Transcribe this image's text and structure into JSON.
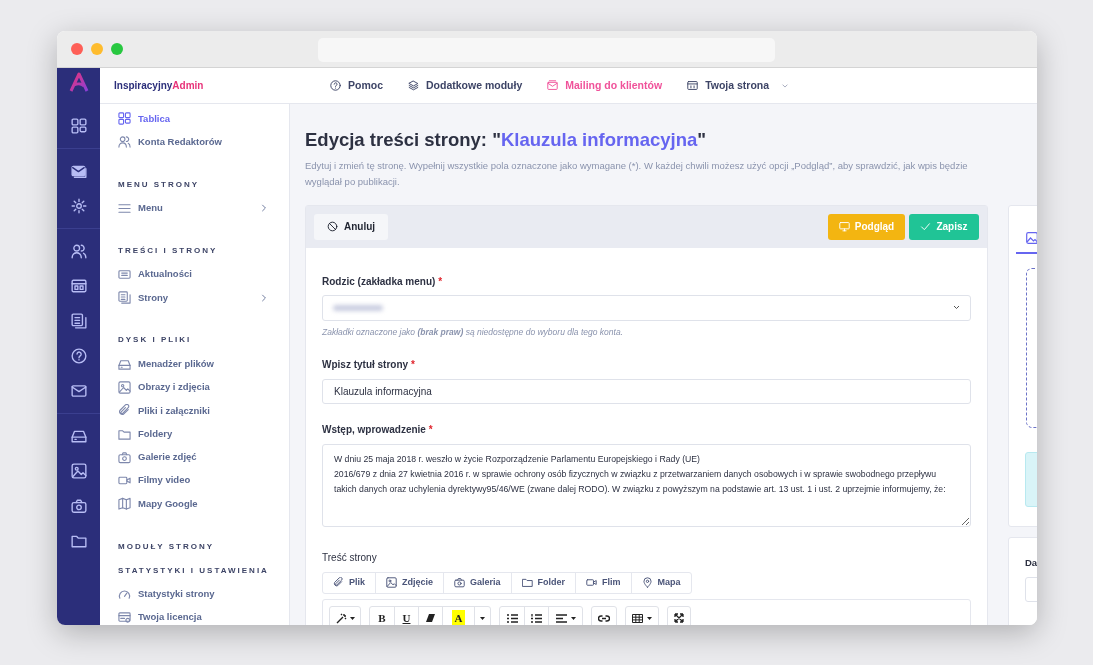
{
  "topbar": {
    "brand": {
      "first": "Inspiracyjny",
      "second": "Admin"
    },
    "nav": [
      {
        "label": "Pomoc",
        "selected": false,
        "dropdown": false
      },
      {
        "label": "Dodatkowe moduły",
        "selected": false,
        "dropdown": false
      },
      {
        "label": "Mailing do klientów",
        "selected": true,
        "dropdown": false
      },
      {
        "label": "Twoja strona",
        "selected": false,
        "dropdown": true
      }
    ]
  },
  "sidebar": {
    "sections": [
      {
        "items": [
          {
            "label": "Tablica",
            "selected": true,
            "submenu": false
          },
          {
            "label": "Konta Redaktorów",
            "selected": false,
            "submenu": false
          }
        ]
      },
      {
        "heading": "MENU STRONY",
        "items": [
          {
            "label": "Menu",
            "selected": false,
            "submenu": true
          }
        ]
      },
      {
        "heading": "TREŚCI I STRONY",
        "items": [
          {
            "label": "Aktualności",
            "selected": false,
            "submenu": false
          },
          {
            "label": "Strony",
            "selected": false,
            "submenu": true
          }
        ]
      },
      {
        "heading": "DYSK I PLIKI",
        "items": [
          {
            "label": "Menadżer plików",
            "selected": false,
            "submenu": false
          },
          {
            "label": "Obrazy i zdjęcia",
            "selected": false,
            "submenu": false
          },
          {
            "label": "Pliki i załączniki",
            "selected": false,
            "submenu": false
          },
          {
            "label": "Foldery",
            "selected": false,
            "submenu": false
          },
          {
            "label": "Galerie zdjęć",
            "selected": false,
            "submenu": false
          },
          {
            "label": "Filmy video",
            "selected": false,
            "submenu": false
          },
          {
            "label": "Mapy Google",
            "selected": false,
            "submenu": false
          }
        ]
      },
      {
        "heading": "MODUŁY STRONY"
      },
      {
        "heading": "STATYSTYKI I USTAWIENIA",
        "items": [
          {
            "label": "Statystyki strony",
            "selected": false,
            "submenu": false
          },
          {
            "label": "Twoja licencja",
            "selected": false,
            "submenu": false
          }
        ]
      }
    ]
  },
  "page": {
    "title_prefix": "Edycja treści strony: \"",
    "title_highlight": "Klauzula informacyjna",
    "title_suffix": "\"",
    "description": "Edytuj i zmień tę stronę. Wypełnij wszystkie pola oznaczone jako wymagane (*). W każdej chwili możesz użyć opcji „Podgląd”, aby sprawdzić, jak wpis będzie wyglądał po publikacji."
  },
  "form": {
    "cancel": "Anuluj",
    "preview": "Podgląd",
    "save": "Zapisz",
    "parent": {
      "label": "Rodzic (zakładka menu)",
      "required_mark": "*",
      "hint": "Zakładki oznaczone jako **(brak praw)** są niedostępne do wyboru dla tego konta."
    },
    "title_field": {
      "label": "Wpisz tytuł strony",
      "required_mark": "*",
      "value": "Klauzula informacyjna"
    },
    "intro": {
      "label": "Wstęp, wprowadzenie",
      "required_mark": "*",
      "value": "W dniu 25 maja 2018 r. weszło w życie Rozporządzenie Parlamentu Europejskiego i Rady (UE)\n2016/679 z dnia 27 kwietnia 2016 r. w sprawie ochrony osób fizycznych w związku z przetwarzaniem danych osobowych i w sprawie swobodnego przepływu takich danych oraz uchylenia dyrektywy95/46/WE (zwane dalej RODO). W związku z powyższym na podstawie art. 13 ust. 1 i ust. 2 uprzejmie informujemy, że:"
    },
    "content": {
      "label": "Treść strony",
      "insert_buttons": [
        "Plik",
        "Zdjęcie",
        "Galeria",
        "Folder",
        "Flim",
        "Mapa"
      ],
      "bold": "B",
      "underline": "U",
      "text_color": "A"
    }
  },
  "side_panel": {
    "date_label": "Da"
  }
}
